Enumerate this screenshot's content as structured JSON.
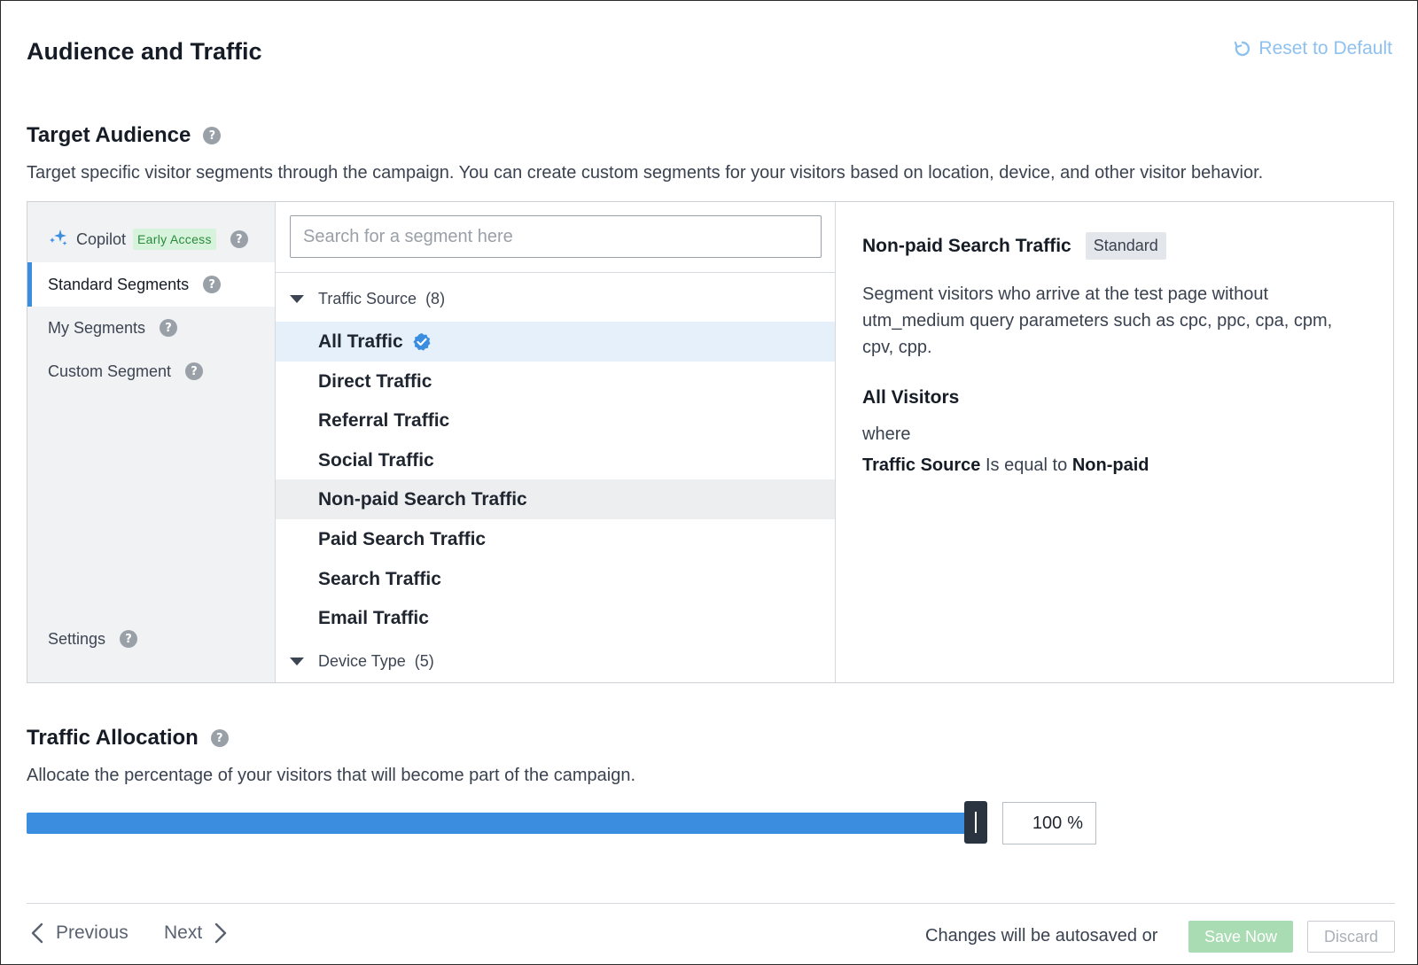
{
  "header": {
    "title": "Audience and Traffic",
    "reset_label": "Reset to Default",
    "reset_icon": "refresh-icon"
  },
  "target_audience": {
    "title": "Target Audience",
    "description": "Target specific visitor segments through the campaign. You can create custom segments for your visitors based on location, device, and other visitor behavior."
  },
  "sidebar": {
    "copilot_label": "Copilot",
    "copilot_badge": "Early Access",
    "items": [
      {
        "label": "Standard Segments",
        "active": true
      },
      {
        "label": "My Segments",
        "active": false
      },
      {
        "label": "Custom Segment",
        "active": false
      }
    ],
    "settings_label": "Settings"
  },
  "segments": {
    "search_placeholder": "Search for a segment here",
    "search_value": "",
    "groups": [
      {
        "name": "Traffic Source",
        "count": "(8)",
        "items": [
          {
            "label": "All Traffic",
            "selected": true
          },
          {
            "label": "Direct Traffic"
          },
          {
            "label": "Referral Traffic"
          },
          {
            "label": "Social Traffic"
          },
          {
            "label": "Non-paid Search Traffic",
            "hovered": true
          },
          {
            "label": "Paid Search Traffic"
          },
          {
            "label": "Search Traffic"
          },
          {
            "label": "Email Traffic"
          }
        ]
      },
      {
        "name": "Device Type",
        "count": "(5)"
      }
    ]
  },
  "detail": {
    "title": "Non-paid Search Traffic",
    "badge": "Standard",
    "description": "Segment visitors who arrive at the test page without utm_medium query parameters such as cpc, ppc, cpa, cpm, cpv, cpp.",
    "subtitle": "All Visitors",
    "where": "where",
    "rule_field": "Traffic Source",
    "rule_operator": "Is equal to",
    "rule_value": "Non-paid"
  },
  "traffic_allocation": {
    "title": "Traffic Allocation",
    "description": "Allocate the percentage of your visitors that will become part of the campaign.",
    "value": "100",
    "unit": "%",
    "percent": 100
  },
  "footer": {
    "previous_label": "Previous",
    "next_label": "Next",
    "autosave_text": "Changes will be autosaved or",
    "save_label": "Save Now",
    "discard_label": "Discard"
  },
  "colors": {
    "accent": "#3b8de0",
    "save_disabled": "#a9dcb3",
    "reset_link": "#8fc1ef"
  }
}
